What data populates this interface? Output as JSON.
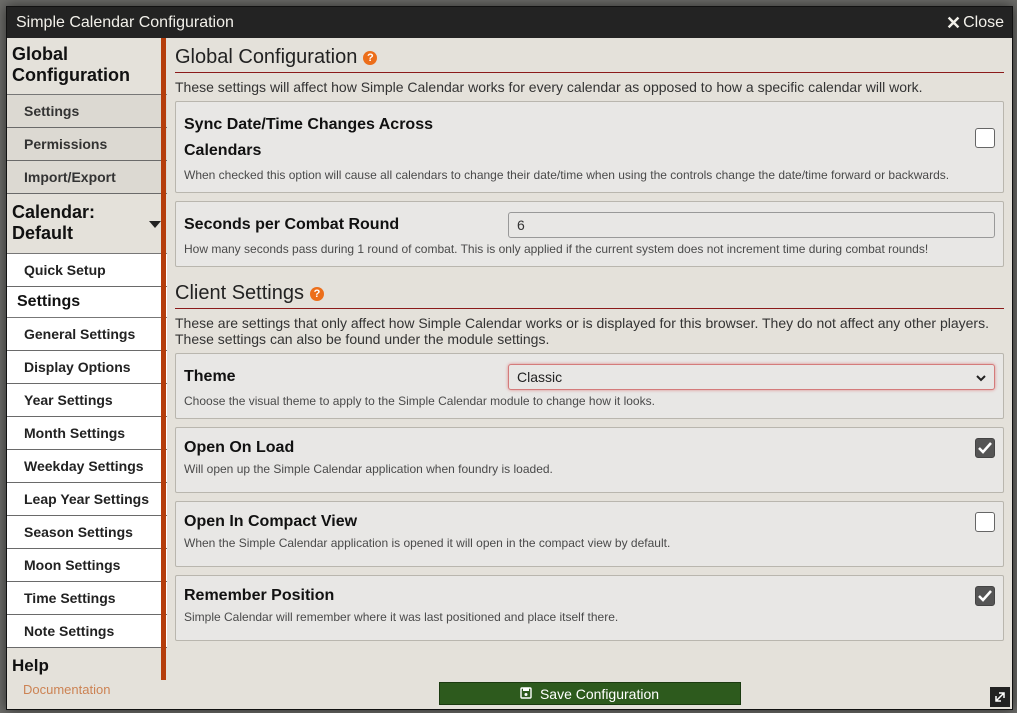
{
  "window": {
    "title": "Simple Calendar Configuration",
    "close_label": "Close"
  },
  "sidebar": {
    "global_heading": "Global Configuration",
    "global_items": [
      "Settings",
      "Permissions",
      "Import/Export"
    ],
    "calendar_heading": "Calendar: Default",
    "quick_setup": "Quick Setup",
    "settings_heading": "Settings",
    "settings_items": [
      "General Settings",
      "Display Options",
      "Year Settings",
      "Month Settings",
      "Weekday Settings",
      "Leap Year Settings",
      "Season Settings",
      "Moon Settings",
      "Time Settings",
      "Note Settings"
    ],
    "help_heading": "Help",
    "documentation": "Documentation"
  },
  "global": {
    "title": "Global Configuration",
    "desc": "These settings will affect how Simple Calendar works for every calendar as opposed to how a specific calendar will work.",
    "sync_label": "Sync Date/Time Changes Across Calendars",
    "sync_note": "When checked this option will cause all calendars to change their date/time when using the controls change the date/time forward or backwards.",
    "sync_checked": false,
    "combat_label": "Seconds per Combat Round",
    "combat_value": "6",
    "combat_note": "How many seconds pass during 1 round of combat. This is only applied if the current system does not increment time during combat rounds!"
  },
  "client": {
    "title": "Client Settings",
    "desc": "These are settings that only affect how Simple Calendar works or is displayed for this browser. They do not affect any other players. These settings can also be found under the module settings.",
    "theme_label": "Theme",
    "theme_value": "Classic",
    "theme_note": "Choose the visual theme to apply to the Simple Calendar module to change how it looks.",
    "open_load_label": "Open On Load",
    "open_load_note": "Will open up the Simple Calendar application when foundry is loaded.",
    "open_load_checked": true,
    "compact_label": "Open In Compact View",
    "compact_note": "When the Simple Calendar application is opened it will open in the compact view by default.",
    "compact_checked": false,
    "remember_label": "Remember Position",
    "remember_note": "Simple Calendar will remember where it was last positioned and place itself there.",
    "remember_checked": true
  },
  "footer": {
    "save_label": "Save Configuration"
  }
}
